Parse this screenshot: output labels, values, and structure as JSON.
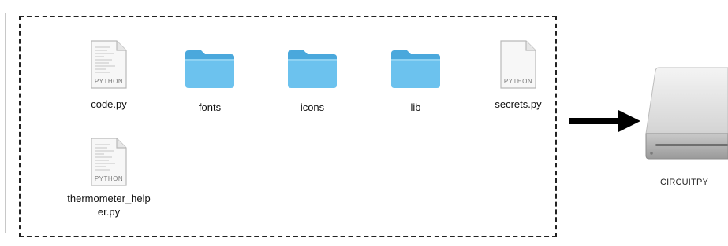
{
  "window": {
    "files": [
      {
        "name": "code.py",
        "kind": "python-file-icon",
        "badge": "PYTHON"
      },
      {
        "name": "fonts",
        "kind": "folder-icon"
      },
      {
        "name": "icons",
        "kind": "folder-icon"
      },
      {
        "name": "lib",
        "kind": "folder-icon"
      },
      {
        "name": "secrets.py",
        "kind": "python-file-icon",
        "badge": "PYTHON"
      },
      {
        "name": "thermometer_helper.py",
        "kind": "python-file-icon",
        "badge": "PYTHON",
        "display_lines": [
          "thermometer_help",
          "er.py"
        ]
      }
    ]
  },
  "arrow": {
    "icon": "right-arrow-icon"
  },
  "drive": {
    "name": "CIRCUITPY",
    "icon": "external-drive-icon"
  },
  "colors": {
    "folder": "#5cb8e8",
    "folder_tab": "#73c6ef",
    "border": "#222222",
    "arrow": "#000000"
  }
}
